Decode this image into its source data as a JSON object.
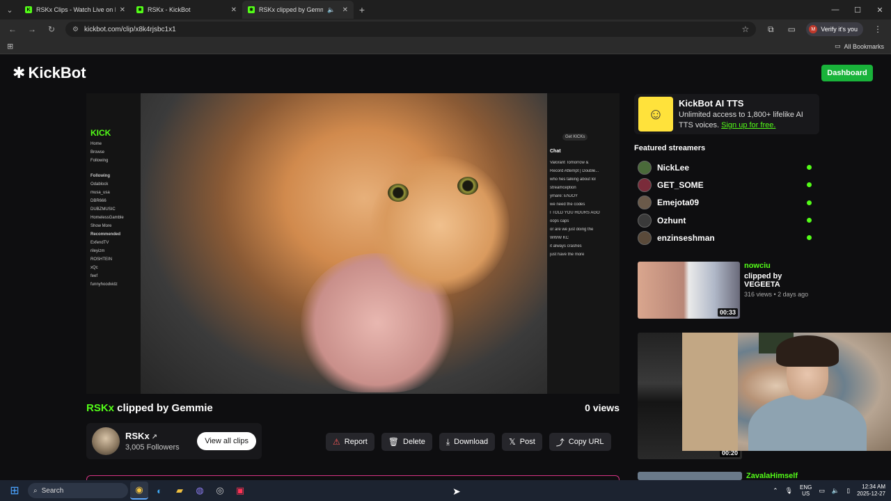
{
  "browser": {
    "tabs": [
      {
        "title": "RSKx Clips - Watch Live on Kick",
        "active": false
      },
      {
        "title": "RSKx - KickBot",
        "active": false
      },
      {
        "title": "RSKx clipped by Gemmie",
        "active": true
      }
    ],
    "url": "kickbot.com/clip/x8k4rjsbc1x1",
    "profile_label": "Verify it's you",
    "profile_initial": "M",
    "bookmarks_label": "All Bookmarks"
  },
  "page": {
    "logo_text": "KickBot",
    "dashboard_label": "Dashboard"
  },
  "clip": {
    "streamer": "RSKx",
    "clipped_by_text": " clipped by Gemmie",
    "views": "0 views",
    "video_overlay": {
      "kick_logo": "KICK",
      "nav": [
        "Home",
        "Browse",
        "Following"
      ],
      "following_header": "Following",
      "following": [
        "Odablock",
        "musa_usa",
        "DBR666",
        "DUBZMUSIC",
        "HomelessGamble"
      ],
      "show_more": "Show More",
      "recommended_header": "Recommended",
      "recommended": [
        "ExfendTV",
        "rileyizm",
        "ROSHTEIN",
        "xQc",
        "feef",
        "funnyhoodvidz"
      ],
      "chat_header": "Chat",
      "get_kicks": "Get KICKs",
      "chat_lines": [
        "Valorant Tomorrow &",
        "Record Attempt | Double...",
        "who hes talking about lol",
        "streamception",
        "ymare: ENJOY",
        "we need the codes",
        "I TOLD YOU HOURS AGO",
        "oops caps",
        "or are we just doing the",
        "WWW KC",
        "it always crashes",
        "just have the more"
      ]
    }
  },
  "channel": {
    "name": "RSKx",
    "followers": "3,005 Followers",
    "view_all_label": "View all clips"
  },
  "actions": [
    {
      "name": "report-button",
      "icon": "warning-icon",
      "glyph": "⚠",
      "label": "Report"
    },
    {
      "name": "delete-button",
      "icon": "trash-icon",
      "glyph": "🗑",
      "label": "Delete"
    },
    {
      "name": "download-button",
      "icon": "download-icon",
      "glyph": "⤓",
      "label": "Download"
    },
    {
      "name": "post-button",
      "icon": "x-logo-icon",
      "glyph": "𝕏",
      "label": "Post"
    },
    {
      "name": "copy-url-button",
      "icon": "share-icon",
      "glyph": "⤴",
      "label": "Copy URL"
    }
  ],
  "sidebar": {
    "tts": {
      "title": "KickBot AI TTS",
      "desc": "Unlimited access to 1,800+ lifelike AI TTS voices.",
      "link": "Sign up for free."
    },
    "featured_header": "Featured streamers",
    "streamers": [
      "NickLee",
      "GET_SOME",
      "Emejota09",
      "Ozhunt",
      "enzinseshman"
    ],
    "clips": [
      {
        "streamer": "nowciu",
        "by": "clipped by VEGEETA",
        "meta": "316 views • 2 days ago",
        "duration": "00:33"
      },
      {
        "streamer": "",
        "by": "",
        "meta": "",
        "duration": "00:20"
      },
      {
        "streamer": "ZavalaHimself",
        "by": "",
        "meta": "",
        "duration": ""
      }
    ]
  },
  "taskbar": {
    "search_placeholder": "Search",
    "lang_top": "ENG",
    "lang_bottom": "US",
    "time": "12:34 AM",
    "date": "2025-12-27"
  },
  "colors": {
    "accent_green": "#53fc18",
    "dashboard_green": "#19b33a",
    "background": "#0e0e10"
  }
}
